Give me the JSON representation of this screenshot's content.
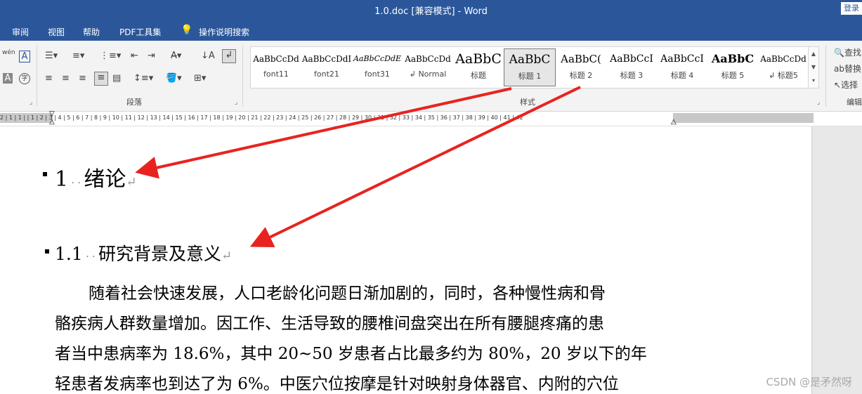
{
  "window": {
    "title": "1.0.doc [兼容模式]  -  Word",
    "login": "登录"
  },
  "menu": [
    "审阅",
    "视图",
    "帮助",
    "PDF工具集",
    "操作说明搜索"
  ],
  "ribbon": {
    "font_group": {
      "phonetic": "wén",
      "char_border": "A",
      "char_shading": "A",
      "enclosed": "字"
    },
    "paragraph_label": "段落",
    "styles_label": "样式",
    "editing_label": "编辑",
    "styles": [
      {
        "preview": "AaBbCcDd",
        "name": "font11"
      },
      {
        "preview": "AaBbCcDdI",
        "name": "font21"
      },
      {
        "preview": "AaBbCcDdE",
        "name": "font31"
      },
      {
        "preview": "AaBbCcDd",
        "name": "↲ Normal"
      },
      {
        "preview": "AaBbC",
        "name": "标题"
      },
      {
        "preview": "AaBbC",
        "name": "标题 1"
      },
      {
        "preview": "AaBbC(",
        "name": "标题 2"
      },
      {
        "preview": "AaBbCcI",
        "name": "标题 3"
      },
      {
        "preview": "AaBbCcI",
        "name": "标题 4"
      },
      {
        "preview": "AaBbC",
        "name": "标题 5"
      },
      {
        "preview": "AaBbCcDd",
        "name": "↲ 标题5"
      }
    ],
    "editing": {
      "find": "查找",
      "replace": "替换",
      "select": "选择"
    }
  },
  "ruler_text": "2 | 1 | 1 | | 1 | 2 | 3 | 4 | 5 | 6 | 7 | 8 | 9 | 10 | 11 | 12 | 13 | 14 | 15 | 16 | 17 | 18 | 19 | 20 | 21 | 22 | 23 | 24 | 25 | 26 | 27 | 28 | 29 | 30 | 31 | 32 | 33 | 34 | 35 | 36 | 37 | 38 | 39 | 40 | 41 | 42",
  "document": {
    "heading1": {
      "number": "1",
      "text": "绪论"
    },
    "heading2": {
      "number": "1.1",
      "text": "研究背景及意义"
    },
    "paragraph_lines": [
      "随着社会快速发展，人口老龄化问题日渐加剧的，同时，各种慢性病和骨",
      "骼疾病人群数量增加。因工作、生活导致的腰椎间盘突出在所有腰腿疼痛的患",
      "者当中患病率为 18.6%，其中 20~50 岁患者占比最多约为 80%，20 岁以下的年",
      "轻患者发病率也到达了为 6%。中医穴位按摩是针对映射身体器官、内附的穴位"
    ]
  },
  "watermark": "CSDN @是矛然呀",
  "colors": {
    "word_blue": "#2b579a",
    "arrow_red": "#e8231f"
  }
}
